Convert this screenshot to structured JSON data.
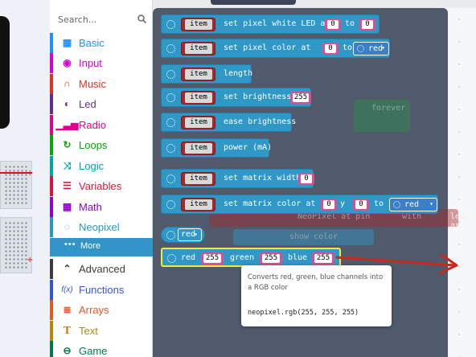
{
  "toolbox": {
    "search_placeholder": "Search...",
    "categories": [
      {
        "label": "Basic",
        "color": "#1e90ff",
        "icon": "grid-icon"
      },
      {
        "label": "Input",
        "color": "#d400d4",
        "icon": "target-icon"
      },
      {
        "label": "Music",
        "color": "#e63022",
        "icon": "headphones-icon"
      },
      {
        "label": "Led",
        "color": "#5c2d91",
        "icon": "toggle-icon"
      },
      {
        "label": "Radio",
        "color": "#e3008c",
        "icon": "signal-bars-icon"
      },
      {
        "label": "Loops",
        "color": "#00aa00",
        "icon": "refresh-icon"
      },
      {
        "label": "Logic",
        "color": "#00a4a6",
        "icon": "shuffle-icon"
      },
      {
        "label": "Variables",
        "color": "#dc143c",
        "icon": "list-icon"
      },
      {
        "label": "Math",
        "color": "#9400d3",
        "icon": "calculator-icon"
      },
      {
        "label": "Neopixel",
        "color": "#2699bf",
        "icon": "dotted-circle-icon"
      }
    ],
    "more_label": "More",
    "advanced": [
      {
        "label": "Advanced",
        "color": "#3c3c3c",
        "icon": "chevron-up-icon"
      },
      {
        "label": "Functions",
        "color": "#3455db",
        "icon": "function-icon"
      },
      {
        "label": "Arrays",
        "color": "#e65722",
        "icon": "array-list-icon"
      },
      {
        "label": "Text",
        "color": "#b8860b",
        "icon": "text-icon"
      },
      {
        "label": "Game",
        "color": "#007a4b",
        "icon": "gamepad-icon"
      }
    ]
  },
  "blocks": {
    "item": "item",
    "set_pixel_white": {
      "label": "set pixel white LED at",
      "a": "0",
      "to": "to",
      "b": "0"
    },
    "set_pixel_color": {
      "label": "set pixel color at",
      "a": "0",
      "to": "to",
      "color": "red"
    },
    "length": {
      "label": "length"
    },
    "set_brightness": {
      "label": "set brightness",
      "a": "255"
    },
    "ease_brightness": {
      "label": "ease brightness"
    },
    "power": {
      "label": "power (mA)"
    },
    "set_matrix_width": {
      "label": "set matrix width",
      "a": "0"
    },
    "set_matrix_color": {
      "label": "set matrix color at x",
      "x": "0",
      "y_label": "y",
      "y": "0",
      "to": "to",
      "color": "red"
    },
    "color_red": {
      "color": "red"
    },
    "rgb": {
      "red_label": "red",
      "red": "255",
      "green_label": "green",
      "green": "255",
      "blue_label": "blue",
      "blue": "255"
    }
  },
  "ghosts": {
    "forever": "forever",
    "neopixel_at_pin": "NeoPixel at pin",
    "pin_value": "P0",
    "with": "with",
    "count": "24",
    "leds_as": "leds as",
    "show_color": "show color",
    "show_color_value": "red"
  },
  "tooltip": {
    "description": "Converts red, green, blue channels into a RGB color",
    "signature": "neopixel.rgb(255, 255, 255)"
  },
  "colors": {
    "neopixel_block": "#2f98c7",
    "variable_item": "#a4282c",
    "number_pill": "#d94f8f",
    "arrow": "#c8291f",
    "highlight": "#f5e640"
  }
}
